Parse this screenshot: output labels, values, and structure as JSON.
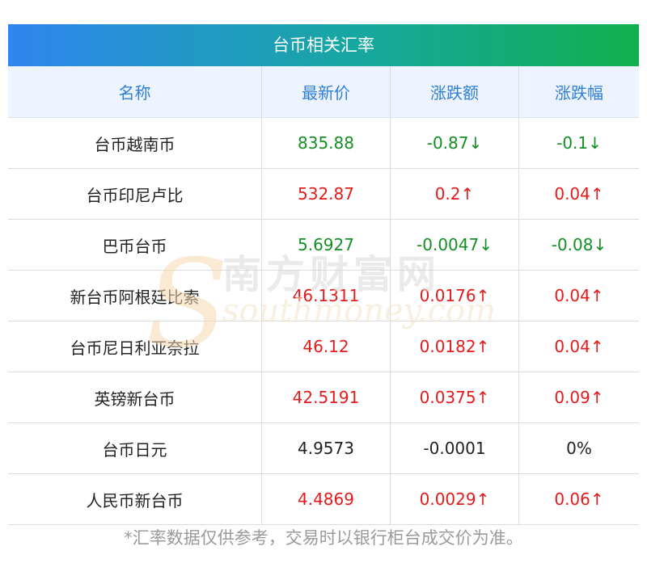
{
  "title": "台币相关汇率",
  "headers": [
    "名称",
    "最新价",
    "涨跌额",
    "涨跌幅"
  ],
  "rows": [
    {
      "name": "台币越南币",
      "price": "835.88",
      "change": "-0.87↓",
      "pct": "-0.1↓",
      "trend": "down"
    },
    {
      "name": "台币印尼卢比",
      "price": "532.87",
      "change": "0.2↑",
      "pct": "0.04↑",
      "trend": "up"
    },
    {
      "name": "巴币台币",
      "price": "5.6927",
      "change": "-0.0047↓",
      "pct": "-0.08↓",
      "trend": "down"
    },
    {
      "name": "新台币阿根廷比索",
      "price": "46.1311",
      "change": "0.0176↑",
      "pct": "0.04↑",
      "trend": "up"
    },
    {
      "name": "台币尼日利亚奈拉",
      "price": "46.12",
      "change": "0.0182↑",
      "pct": "0.04↑",
      "trend": "up"
    },
    {
      "name": "英镑新台币",
      "price": "42.5191",
      "change": "0.0375↑",
      "pct": "0.09↑",
      "trend": "up"
    },
    {
      "name": "台币日元",
      "price": "4.9573",
      "change": "-0.0001",
      "pct": "0%",
      "trend": "flat"
    },
    {
      "name": "人民币新台币",
      "price": "4.4869",
      "change": "0.0029↑",
      "pct": "0.06↑",
      "trend": "up"
    }
  ],
  "watermark": {
    "cn": "南方财富网",
    "en": "southmoney.com",
    "s": "S"
  },
  "footnote": "*汇率数据仅供参考，交易时以银行柜台成交价为准。",
  "colors": {
    "up": "#e31b1b",
    "down": "#148f23",
    "header_text": "#2f7fd8"
  }
}
